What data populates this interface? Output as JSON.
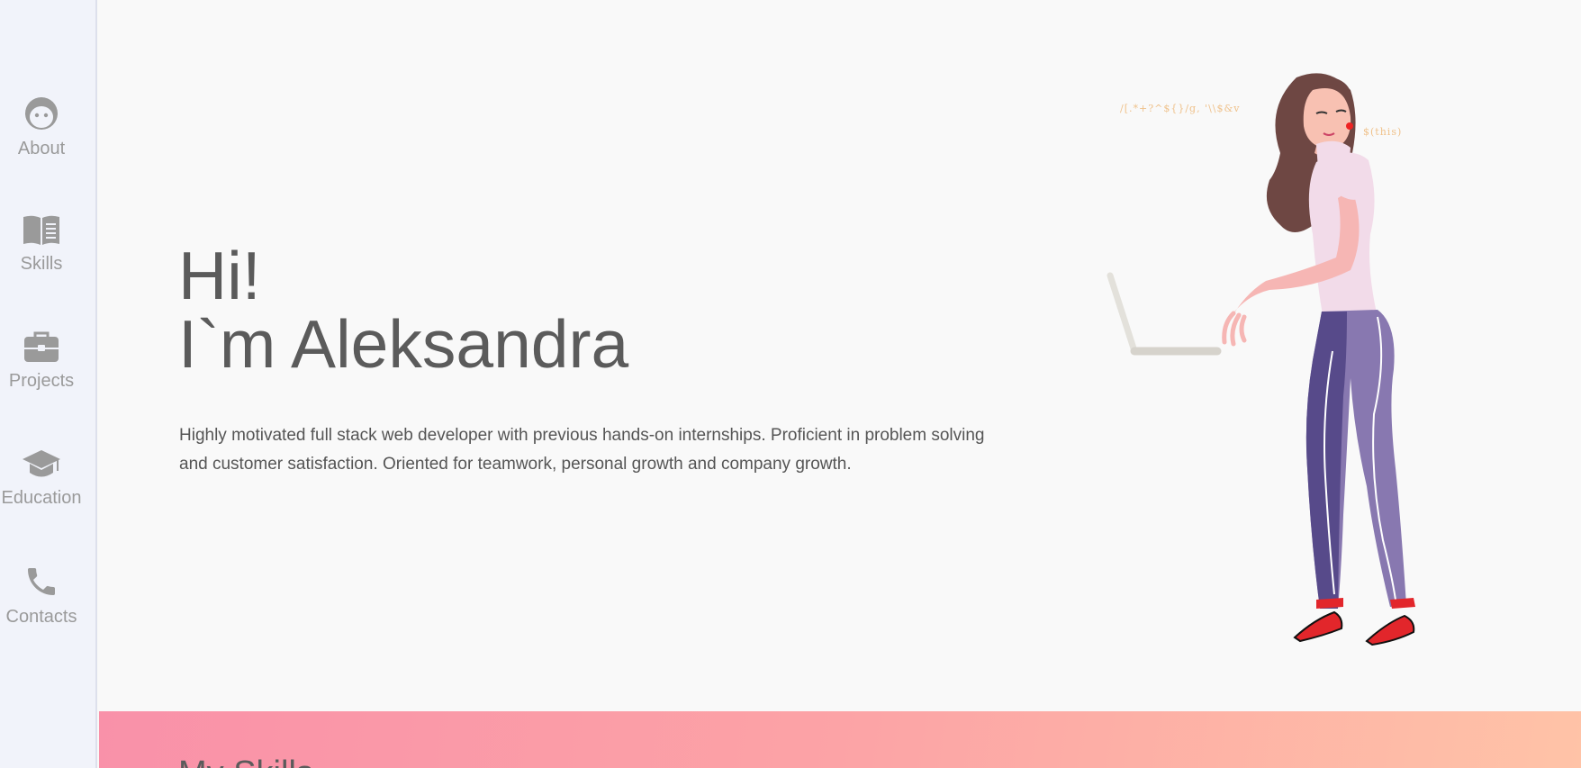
{
  "nav": {
    "items": [
      {
        "label": "About",
        "icon": "face-icon"
      },
      {
        "label": "Skills",
        "icon": "book-icon"
      },
      {
        "label": "Projects",
        "icon": "briefcase-icon"
      },
      {
        "label": "Education",
        "icon": "graduation-cap-icon"
      },
      {
        "label": "Contacts",
        "icon": "phone-icon"
      }
    ]
  },
  "hero": {
    "greeting": "Hi!",
    "name_line": "I`m Aleksandra",
    "description": "Highly motivated full stack web developer with previous hands-on internships. Proficient in problem solving and customer satisfaction. Oriented for teamwork, personal growth and company growth.",
    "code_snippet_1": "/[.*+?^${}/g, '\\\\$&v",
    "code_snippet_2": "$(this)"
  },
  "skills": {
    "heading": "My Skills"
  },
  "colors": {
    "sidebar_bg": "#f1f3fa",
    "page_bg": "#f9f9f9",
    "text": "#5b5b5b",
    "icon": "#9a9a9a",
    "gradient_start": "#f991a9",
    "gradient_end": "#ffc3a7"
  }
}
